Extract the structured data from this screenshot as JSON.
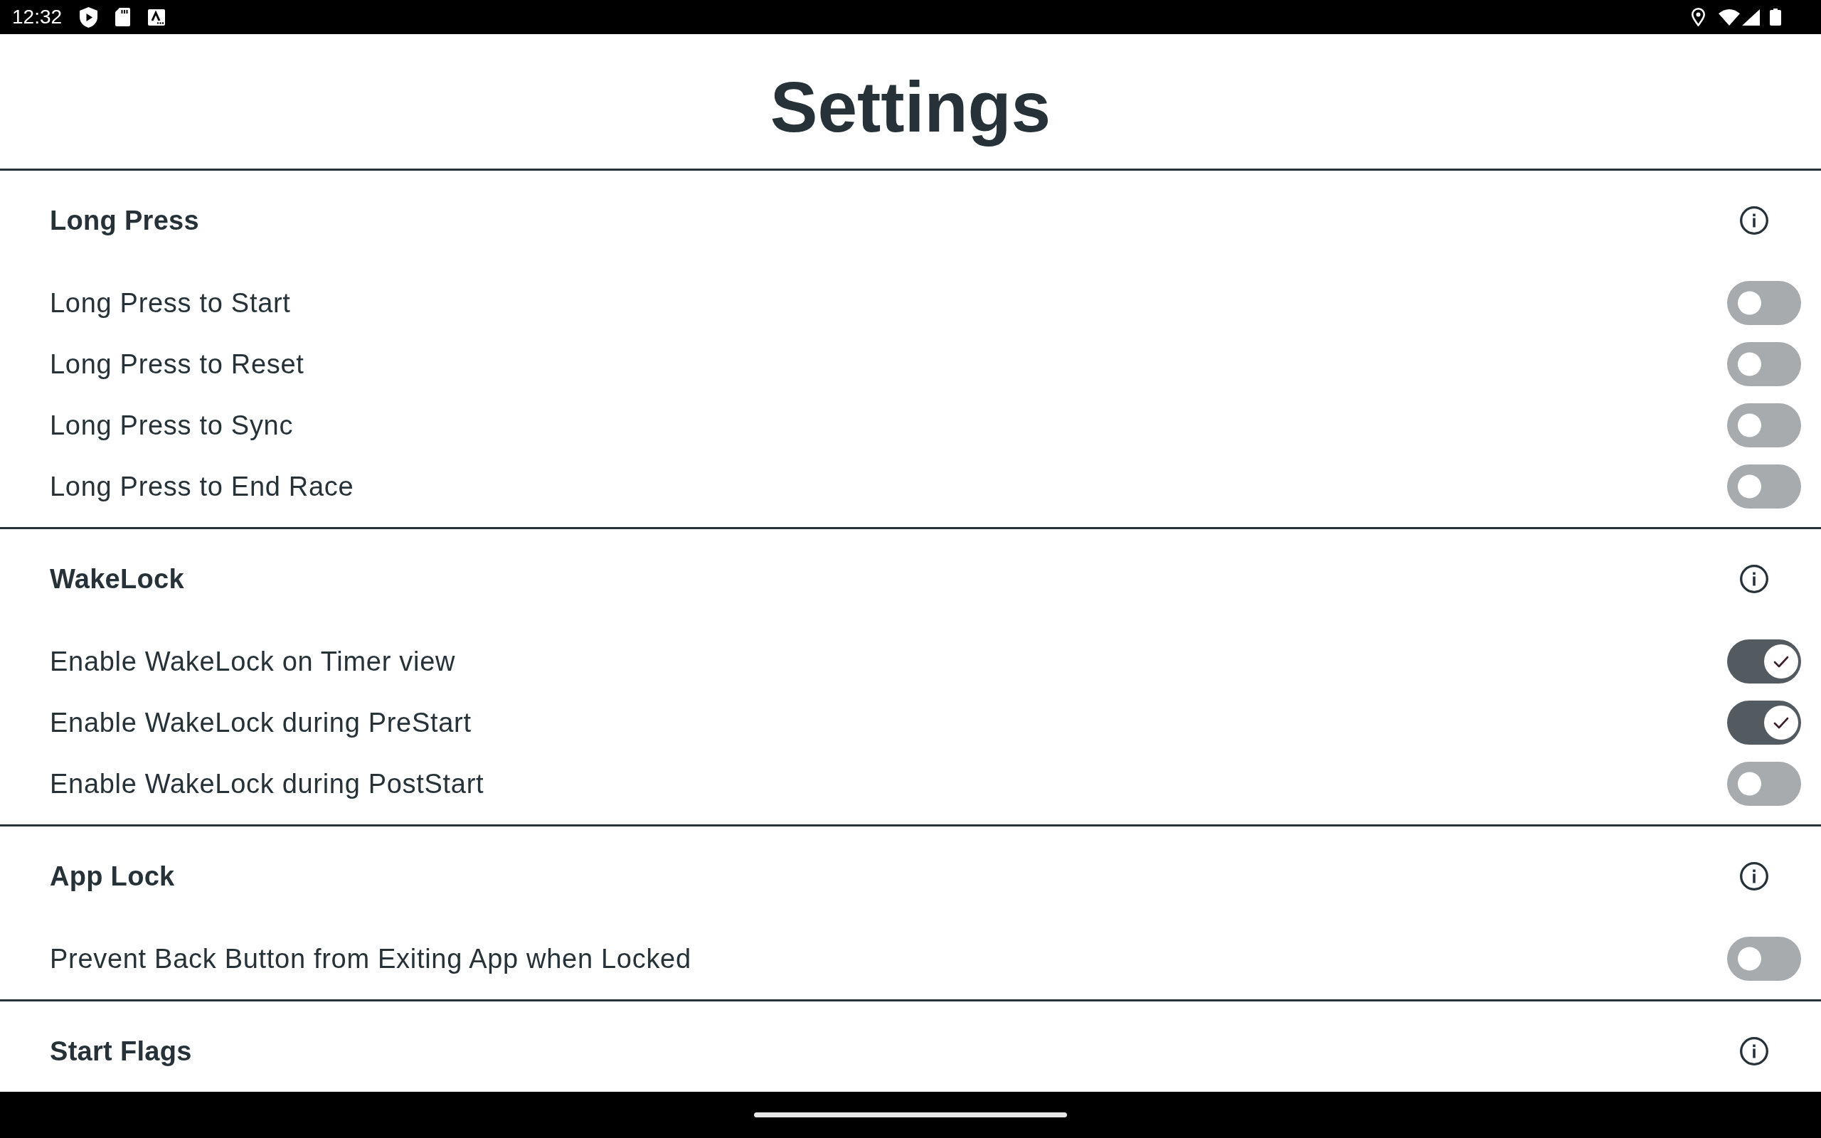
{
  "status_bar": {
    "time": "12:32"
  },
  "title": "Settings",
  "sections": [
    {
      "title": "Long Press",
      "settings": [
        {
          "label": "Long Press to Start",
          "on": false
        },
        {
          "label": "Long Press to Reset",
          "on": false
        },
        {
          "label": "Long Press to Sync",
          "on": false
        },
        {
          "label": "Long Press to End Race",
          "on": false
        }
      ]
    },
    {
      "title": "WakeLock",
      "settings": [
        {
          "label": "Enable WakeLock on Timer view",
          "on": true
        },
        {
          "label": "Enable WakeLock during PreStart",
          "on": true
        },
        {
          "label": "Enable WakeLock during PostStart",
          "on": false
        }
      ]
    },
    {
      "title": "App Lock",
      "settings": [
        {
          "label": "Prevent Back Button from Exiting App when Locked",
          "on": false
        }
      ]
    },
    {
      "title": "Start Flags"
    }
  ]
}
